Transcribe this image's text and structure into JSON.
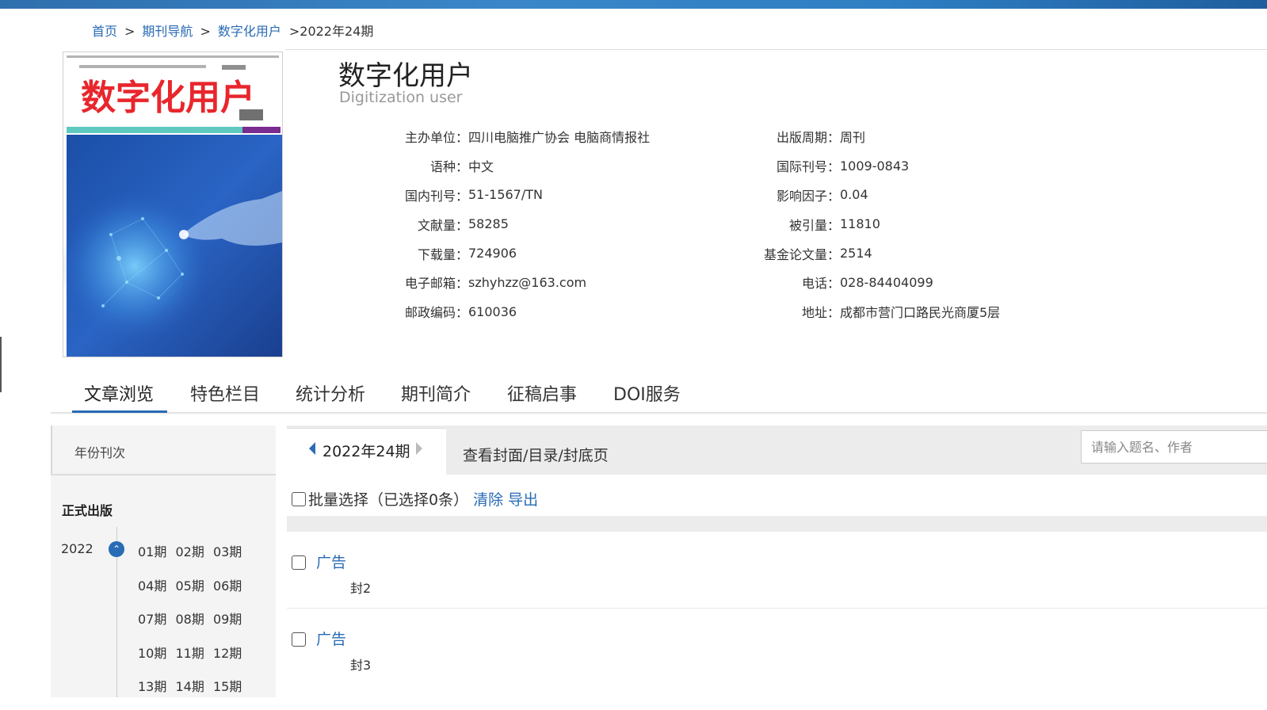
{
  "breadcrumb": {
    "home": "首页",
    "nav": "期刊导航",
    "journal": "数字化用户",
    "current": ">2022年24期",
    "sep": ">"
  },
  "journal": {
    "title_cn": "数字化用户",
    "title_en": "Digitization user",
    "cover_title": "数字化用户"
  },
  "info_left": [
    {
      "label": "主办单位：",
      "value": "四川电脑推广协会 电脑商情报社"
    },
    {
      "label": "语种：",
      "value": "中文"
    },
    {
      "label": "国内刊号：",
      "value": "51-1567/TN"
    },
    {
      "label": "文献量：",
      "value": "58285"
    },
    {
      "label": "下载量：",
      "value": "724906"
    },
    {
      "label": "电子邮箱：",
      "value": "szhyhzz@163.com"
    },
    {
      "label": "邮政编码：",
      "value": "610036"
    }
  ],
  "info_right": [
    {
      "label": "出版周期：",
      "value": "周刊"
    },
    {
      "label": "国际刊号：",
      "value": "1009-0843"
    },
    {
      "label": "影响因子：",
      "value": "0.04"
    },
    {
      "label": "被引量：",
      "value": "11810"
    },
    {
      "label": "基金论文量：",
      "value": "2514"
    },
    {
      "label": "电话：",
      "value": "028-84404099"
    },
    {
      "label": "地址：",
      "value": "成都市营门口路民光商厦5层"
    }
  ],
  "tabs": [
    "文章浏览",
    "特色栏目",
    "统计分析",
    "期刊简介",
    "征稿启事",
    "DOI服务"
  ],
  "sidebar": {
    "heading": "年份刊次",
    "section": "正式出版",
    "year": "2022",
    "issue_rows": [
      [
        "01期",
        "02期",
        "03期"
      ],
      [
        "04期",
        "05期",
        "06期"
      ],
      [
        "07期",
        "08期",
        "09期"
      ],
      [
        "10期",
        "11期",
        "12期"
      ],
      [
        "13期",
        "14期",
        "15期"
      ]
    ]
  },
  "issue_bar": {
    "current_issue": "2022年24期",
    "cover_link": "查看封面/目录/封底页",
    "search_placeholder": "请输入题名、作者"
  },
  "batch": {
    "label": "批量选择（已选择0条）",
    "clear": "清除",
    "export": "导出"
  },
  "articles": [
    {
      "title": "广告",
      "page": "封2"
    },
    {
      "title": "广告",
      "page": "封3"
    }
  ],
  "colors": {
    "accent": "#2a6bb5",
    "cover_red": "#e8262c"
  }
}
